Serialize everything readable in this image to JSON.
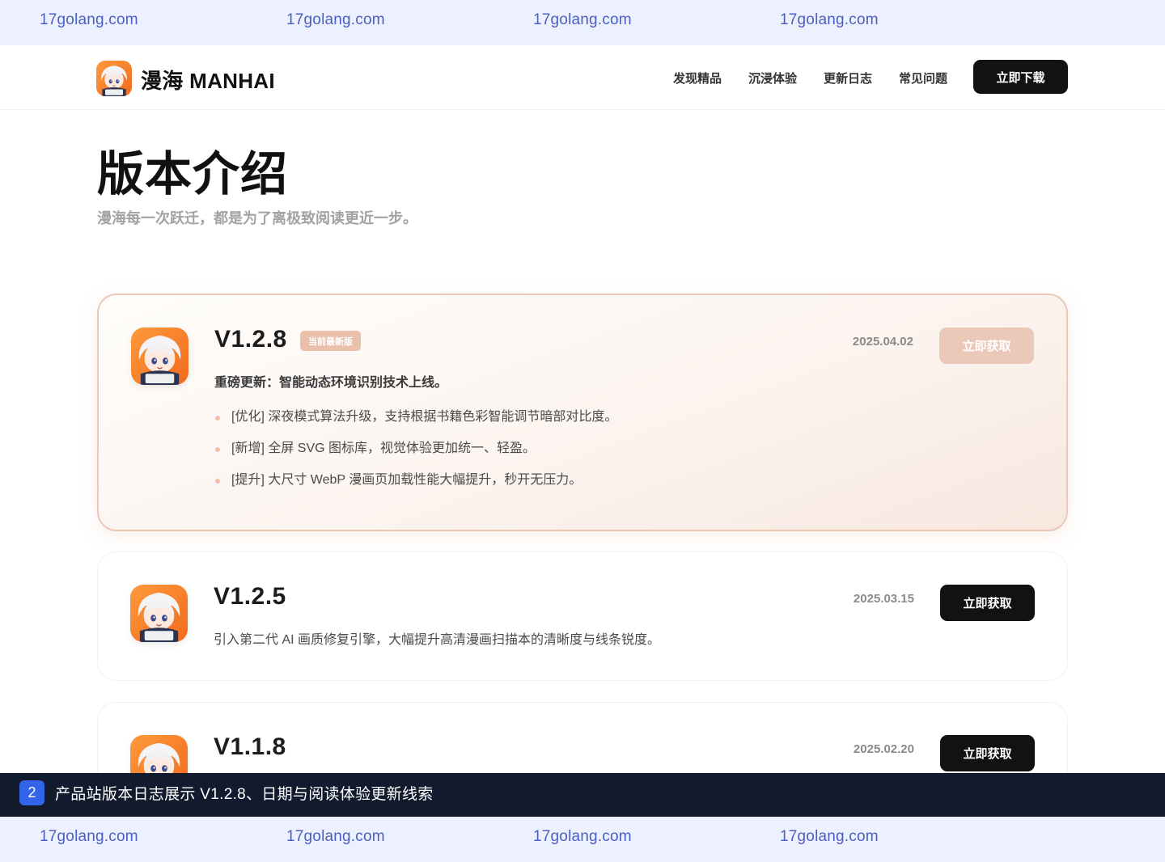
{
  "watermark": {
    "text": "17golang.com"
  },
  "header": {
    "brand": "漫海 MANHAI",
    "nav": [
      "发现精品",
      "沉浸体验",
      "更新日志",
      "常见问题"
    ],
    "download_label": "立即下载"
  },
  "page": {
    "title": "版本介绍",
    "subtitle": "漫海每一次跃迁，都是为了离极致阅读更近一步。"
  },
  "logo_mark_text": "漫海",
  "releases": [
    {
      "version": "V1.2.8",
      "badge": "当前最新版",
      "date": "2025.04.02",
      "button_label": "立即获取",
      "headline": "重磅更新：智能动态环境识别技术上线。",
      "changes": [
        "[优化] 深夜模式算法升级，支持根据书籍色彩智能调节暗部对比度。",
        "[新增] 全屏 SVG 图标库，视觉体验更加统一、轻盈。",
        "[提升] 大尺寸 WebP 漫画页加载性能大幅提升，秒开无压力。"
      ]
    },
    {
      "version": "V1.2.5",
      "date": "2025.03.15",
      "button_label": "立即获取",
      "description": "引入第二代 AI 画质修复引擎，大幅提升高清漫画扫描本的清晰度与线条锐度。"
    },
    {
      "version": "V1.1.8",
      "date": "2025.02.20",
      "button_label": "立即获取"
    }
  ],
  "banner": {
    "number": "2",
    "text": "产品站版本日志展示 V1.2.8、日期与阅读体验更新线索"
  },
  "colors": {
    "accent_peach": "#ebc0aa",
    "dark_button": "#121214",
    "watermark_blue": "#4a5fc1",
    "banner_bg": "#121a2e"
  }
}
